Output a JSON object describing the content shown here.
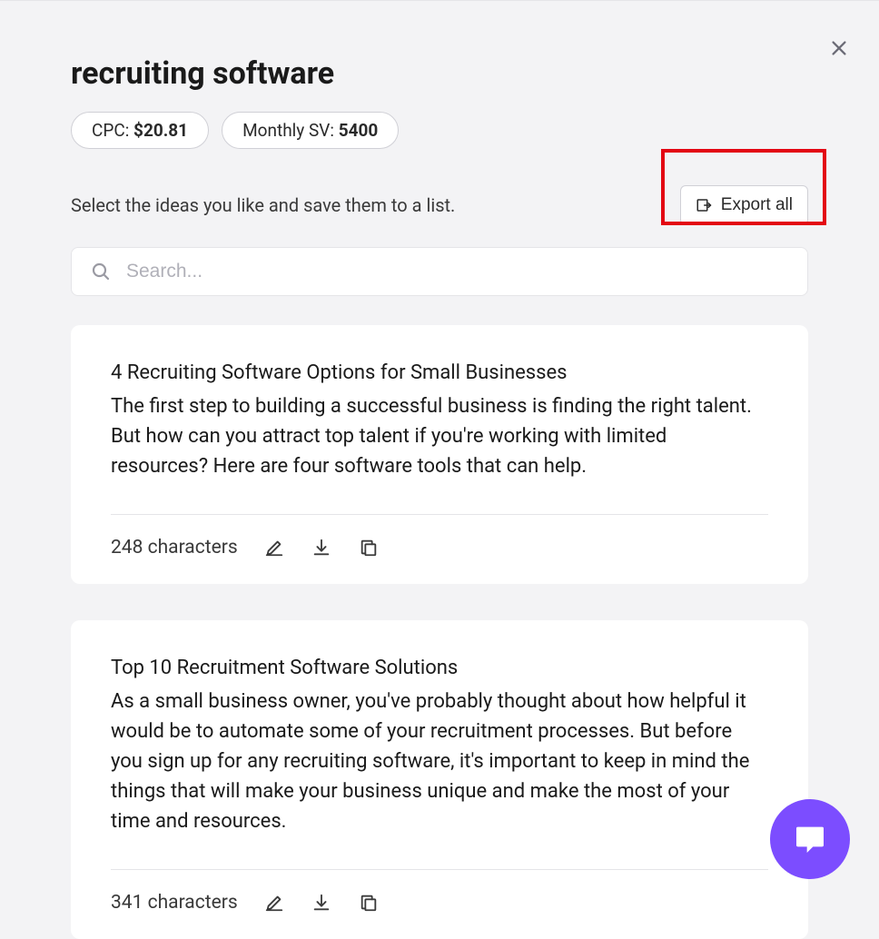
{
  "header": {
    "title": "recruiting software"
  },
  "metrics": {
    "cpc_label": "CPC: ",
    "cpc_value": "$20.81",
    "sv_label": "Monthly SV: ",
    "sv_value": "5400"
  },
  "instruction": "Select the ideas you like and save them to a list.",
  "export_label": "Export all",
  "search": {
    "placeholder": "Search..."
  },
  "cards": [
    {
      "title": "4 Recruiting Software Options for Small Businesses",
      "body": "The first step to building a successful business is finding the right talent. But how can you attract top talent if you're working with limited resources? Here are four software tools that can help.",
      "char_count": "248 characters"
    },
    {
      "title": "Top 10 Recruitment Software Solutions",
      "body": "As a small business owner, you've probably thought about how helpful it would be to automate some of your recruitment processes. But before you sign up for any recruiting software, it's important to keep in mind the things that will make your business unique and make the most of your time and resources.",
      "char_count": "341 characters"
    }
  ],
  "icons": {
    "close": "close-icon",
    "search": "search-icon",
    "export": "export-icon",
    "edit": "edit-icon",
    "download": "download-icon",
    "copy": "copy-icon",
    "chat": "chat-icon"
  }
}
